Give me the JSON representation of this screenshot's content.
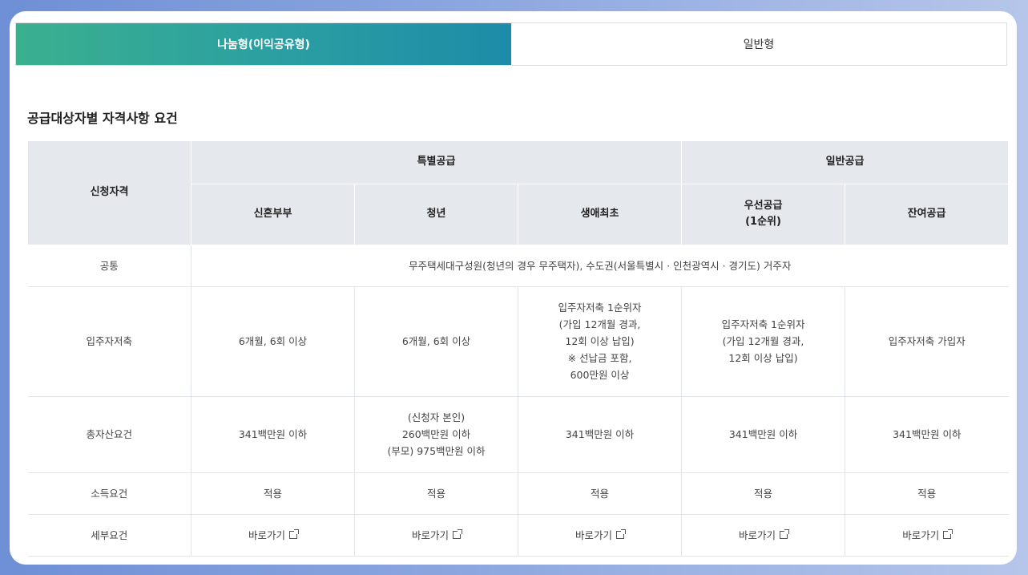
{
  "tabs": [
    {
      "label": "나눔형(이익공유형)",
      "active": true
    },
    {
      "label": "일반형",
      "active": false
    }
  ],
  "section_title": "공급대상자별 자격사항 요건",
  "table": {
    "header": {
      "eligibility": "신청자격",
      "special": "특별공급",
      "general": "일반공급",
      "newlyweds": "신혼부부",
      "youth": "청년",
      "first_time": "생애최초",
      "priority_line1": "우선공급",
      "priority_line2": "(1순위)",
      "remaining": "잔여공급"
    },
    "rows": {
      "common": {
        "label": "공통",
        "value": "무주택세대구성원(청년의 경우 무주택자), 수도권(서울특별시 · 인천광역시 · 경기도) 거주자"
      },
      "savings": {
        "label": "입주자저축",
        "newlyweds": "6개월, 6회 이상",
        "youth": "6개월, 6회 이상",
        "first_time": [
          "입주자저축 1순위자",
          "(가입 12개월 경과,",
          "12회 이상 납입)",
          "※ 선납금 포함,",
          "600만원 이상"
        ],
        "priority": [
          "입주자저축 1순위자",
          "(가입 12개월 경과,",
          "12회 이상 납입)"
        ],
        "remaining": "입주자저축 가입자"
      },
      "assets": {
        "label": "총자산요건",
        "newlyweds": "341백만원 이하",
        "youth": [
          "(신청자 본인)",
          "260백만원 이하",
          "(부모) 975백만원 이하"
        ],
        "first_time": "341백만원 이하",
        "priority": "341백만원 이하",
        "remaining": "341백만원 이하"
      },
      "income": {
        "label": "소득요건",
        "newlyweds": "적용",
        "youth": "적용",
        "first_time": "적용",
        "priority": "적용",
        "remaining": "적용"
      },
      "details": {
        "label": "세부요건",
        "link_label": "바로가기",
        "icon": "external-link-icon"
      }
    }
  },
  "colors": {
    "tab_gradient_start": "#3bb08f",
    "tab_gradient_end": "#1c8ca8",
    "header_bg": "#e5e8ed"
  }
}
